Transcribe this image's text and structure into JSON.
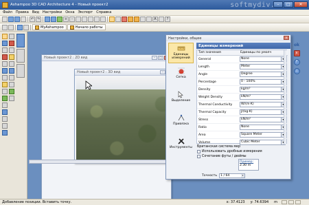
{
  "app": {
    "title": "Ashampoo 3D CAD Architecture 4 - Новый проект2",
    "watermark": "softmydiv.net"
  },
  "menu": [
    "Файл",
    "Правка",
    "Вид",
    "Настройки",
    "Окна",
    "Экспорт",
    "Справка"
  ],
  "doc_tabs": [
    "MyAshampoo",
    "Начало работы"
  ],
  "windows": {
    "plan2d": {
      "title": "Новый проект2 : 2D вид"
    },
    "view3d": {
      "title": "Новый проект2 : 3D вид"
    }
  },
  "settings": {
    "title": "Настройки, общее",
    "header": "Единицы измерений",
    "categories": [
      {
        "label": "Единицы измерений",
        "icon": "ruler-icon"
      },
      {
        "label": "Сетка",
        "icon": "grid-icon"
      },
      {
        "label": "Выделение",
        "icon": "selection-icon"
      },
      {
        "label": "Привязка",
        "icon": "snap-icon"
      },
      {
        "label": "Инструменты",
        "icon": "tools-icon"
      }
    ],
    "table_headers": {
      "name": "Тип значения",
      "value": "Единицы по умолч"
    },
    "rows": [
      {
        "label": "General",
        "value": "None"
      },
      {
        "label": "Length",
        "value": "Meter"
      },
      {
        "label": "Angle",
        "value": "Degree"
      },
      {
        "label": "Percentage",
        "value": "0 - 100%"
      },
      {
        "label": "Density",
        "value": "kg/m³"
      },
      {
        "label": "Weight Density",
        "value": "kN/m³"
      },
      {
        "label": "Thermal Conductivity",
        "value": "W/(m·K)"
      },
      {
        "label": "Thermal Capacity",
        "value": "J/(kg·K)"
      },
      {
        "label": "Stress",
        "value": "kN/m²"
      },
      {
        "label": "Ratio",
        "value": "None"
      },
      {
        "label": "Area",
        "value": "Square Meter"
      },
      {
        "label": "Volume",
        "value": "Cubic Meter"
      }
    ],
    "british_title": "Британская система мер",
    "check1": "Использовать дробные измерения",
    "check2": "Сочетание футы / дюймы",
    "example_label": "Пример:",
    "example_value": "2.30 m",
    "precision_label": "Точность",
    "precision_value": "1 / 64"
  },
  "right_panel": {
    "ok": "ok"
  },
  "status": {
    "hint": "Добавление позиции. Вставить точку.",
    "x": "x: 37.4123",
    "y": "y: 74.6394",
    "zoom": "m"
  }
}
